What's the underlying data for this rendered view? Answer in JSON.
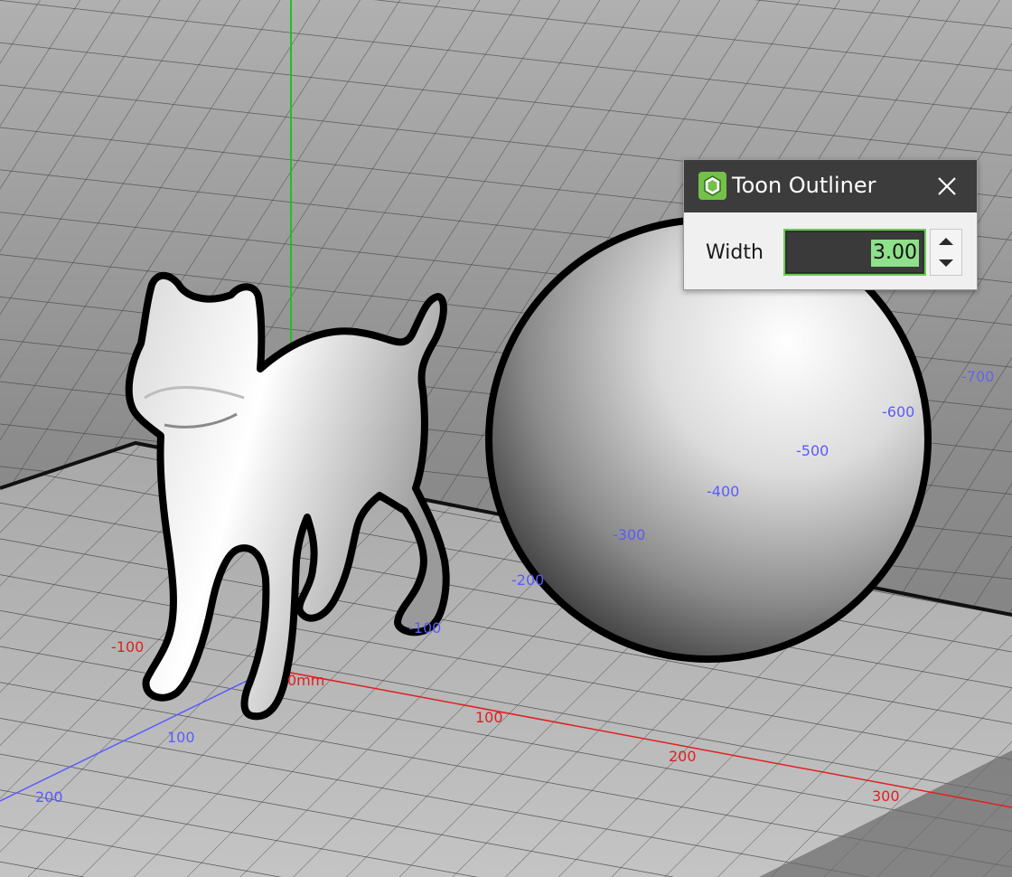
{
  "dialog": {
    "title": "Toon Outliner",
    "width_label": "Width",
    "width_value": "3.00",
    "accent_color": "#74c049",
    "icons": {
      "app": "toon-outliner-app-icon",
      "close": "close-icon",
      "increment": "chevron-up-icon",
      "decrement": "chevron-down-icon"
    }
  },
  "viewport": {
    "origin_label": "0mm",
    "x_axis_labels": [
      "100",
      "200",
      "300"
    ],
    "x_axis_negative_labels": [
      "-100"
    ],
    "z_axis_labels": [
      "100",
      "200"
    ],
    "z_axis_negative_labels": [
      "-100",
      "-200",
      "-300",
      "-400",
      "-500",
      "-600",
      "-700"
    ],
    "colors": {
      "x_axis": "#e02020",
      "y_axis": "#20c020",
      "z_axis": "#5a5aff",
      "outline": "#000000",
      "grid_line": "#2e2e2e"
    },
    "objects": [
      "dog",
      "sphere"
    ]
  }
}
